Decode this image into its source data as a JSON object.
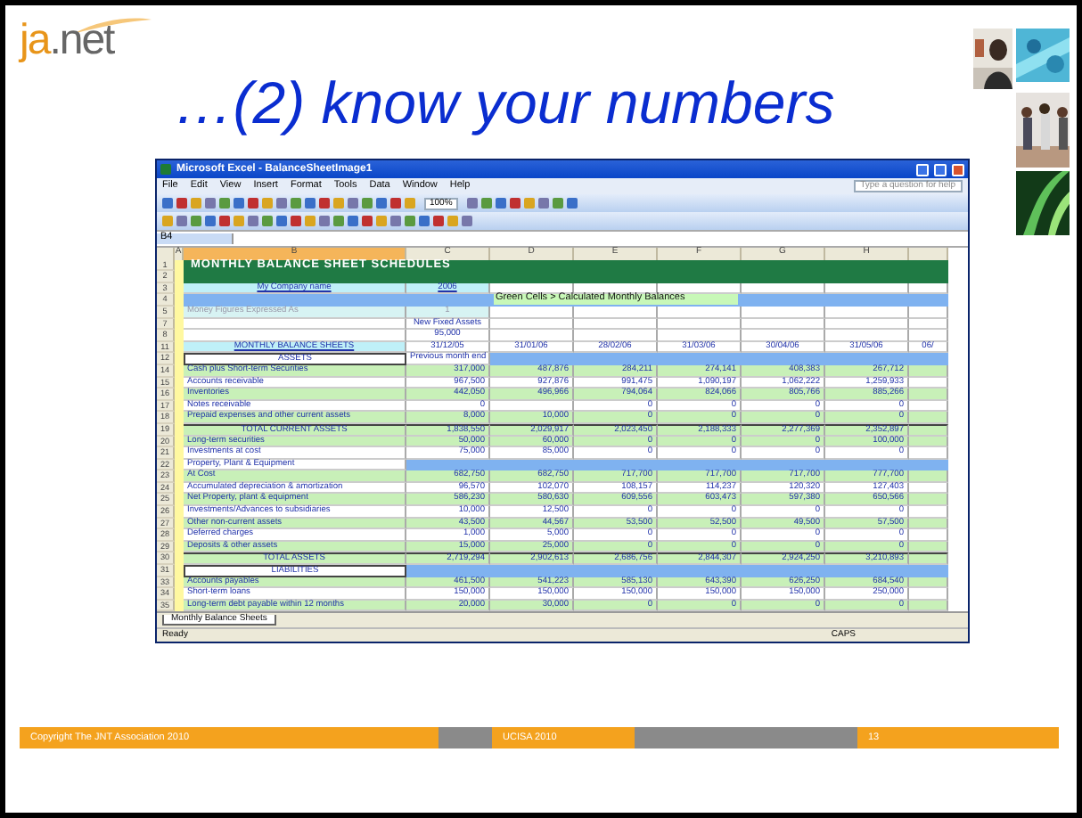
{
  "logo": {
    "prefix": "ja",
    "suffix": ".net"
  },
  "title": "…(2) know your numbers",
  "excel": {
    "window_title": "Microsoft Excel - BalanceSheetImage1",
    "menu": [
      "File",
      "Edit",
      "View",
      "Insert",
      "Format",
      "Tools",
      "Data",
      "Window",
      "Help"
    ],
    "help_placeholder": "Type a question for help",
    "zoom": "100%",
    "name_box": "B4",
    "columns": [
      "A",
      "B",
      "C",
      "D",
      "E",
      "F",
      "G",
      "H"
    ],
    "rows": [
      {
        "num": "1",
        "kind": "title",
        "label": "MONTHLY BALANCE SHEET SCHEDULES",
        "cells": []
      },
      {
        "num": "2",
        "kind": "title",
        "label": "",
        "cells": []
      },
      {
        "num": "3",
        "kind": "company",
        "label": "My Company name",
        "cells": [
          "2006"
        ]
      },
      {
        "num": "4",
        "kind": "banner",
        "label": "",
        "cells": [
          ""
        ],
        "note": "Green Cells > Calculated Monthly Balances"
      },
      {
        "num": "5",
        "kind": "grey",
        "label": "Money Figures Expressed As",
        "cells": [
          "1"
        ]
      },
      {
        "num": "7",
        "kind": "plain",
        "label": "",
        "cells": [
          "New Fixed Assets"
        ]
      },
      {
        "num": "8",
        "kind": "plain",
        "label": "",
        "cells": [
          "95,000"
        ]
      },
      {
        "num": "11",
        "kind": "dates",
        "label": "MONTHLY BALANCE SHEETS",
        "cells": [
          "31/12/05",
          "31/01/06",
          "28/02/06",
          "31/03/06",
          "30/04/06",
          "31/05/06",
          "06/"
        ]
      },
      {
        "num": "12",
        "kind": "section",
        "label": "ASSETS",
        "cells": [
          "Previous month end"
        ]
      },
      {
        "num": "14",
        "kind": "green",
        "label": "Cash plus Short-term Securities",
        "cells": [
          "317,000",
          "487,876",
          "284,211",
          "274,141",
          "408,383",
          "267,712"
        ]
      },
      {
        "num": "15",
        "kind": "white",
        "label": "Accounts receivable",
        "cells": [
          "967,500",
          "927,876",
          "991,475",
          "1,090,197",
          "1,062,222",
          "1,259,933"
        ]
      },
      {
        "num": "16",
        "kind": "green",
        "label": "Inventories",
        "cells": [
          "442,050",
          "496,966",
          "794,064",
          "824,066",
          "805,766",
          "885,266"
        ]
      },
      {
        "num": "17",
        "kind": "white",
        "label": "Notes receivable",
        "cells": [
          "0",
          "",
          "0",
          "0",
          "0",
          "0"
        ]
      },
      {
        "num": "18",
        "kind": "green",
        "label": "Prepaid expenses and other current assets",
        "cells": [
          "8,000",
          "10,000",
          "0",
          "0",
          "0",
          "0"
        ]
      },
      {
        "num": "19",
        "kind": "total",
        "label": "TOTAL CURRENT ASSETS",
        "cells": [
          "1,838,550",
          "2,029,917",
          "2,023,450",
          "2,188,333",
          "2,277,369",
          "2,352,897"
        ]
      },
      {
        "num": "20",
        "kind": "green",
        "label": "Long-term securities",
        "cells": [
          "50,000",
          "60,000",
          "0",
          "0",
          "0",
          "100,000"
        ]
      },
      {
        "num": "21",
        "kind": "white",
        "label": "Investments at cost",
        "cells": [
          "75,000",
          "85,000",
          "0",
          "0",
          "0",
          "0"
        ]
      },
      {
        "num": "22",
        "kind": "band",
        "label": "Property, Plant & Equipment",
        "cells": []
      },
      {
        "num": "23",
        "kind": "green",
        "label": "At Cost",
        "cells": [
          "682,750",
          "682,750",
          "717,700",
          "717,700",
          "717,700",
          "777,700"
        ]
      },
      {
        "num": "24",
        "kind": "white",
        "label": "Accumulated depreciation & amortization",
        "cells": [
          "96,570",
          "102,070",
          "108,157",
          "114,237",
          "120,320",
          "127,403"
        ]
      },
      {
        "num": "25",
        "kind": "green",
        "label": "Net Property, plant & equipment",
        "cells": [
          "586,230",
          "580,630",
          "609,556",
          "603,473",
          "597,380",
          "650,566"
        ]
      },
      {
        "num": "26",
        "kind": "white",
        "label": "Investments/Advances to subsidiaries",
        "cells": [
          "10,000",
          "12,500",
          "0",
          "0",
          "0",
          "0"
        ]
      },
      {
        "num": "27",
        "kind": "green",
        "label": "Other non-current assets",
        "cells": [
          "43,500",
          "44,567",
          "53,500",
          "52,500",
          "49,500",
          "57,500"
        ]
      },
      {
        "num": "28",
        "kind": "white",
        "label": "Deferred charges",
        "cells": [
          "1,000",
          "5,000",
          "0",
          "0",
          "0",
          "0"
        ]
      },
      {
        "num": "29",
        "kind": "green",
        "label": "Deposits & other assets",
        "cells": [
          "15,000",
          "25,000",
          "0",
          "0",
          "0",
          "0"
        ]
      },
      {
        "num": "30",
        "kind": "total",
        "label": "TOTAL ASSETS",
        "cells": [
          "2,719,294",
          "2,902,613",
          "2,686,756",
          "2,844,307",
          "2,924,250",
          "3,210,893"
        ]
      },
      {
        "num": "31",
        "kind": "section",
        "label": "LIABILITIES",
        "cells": []
      },
      {
        "num": "33",
        "kind": "green",
        "label": "Accounts payables",
        "cells": [
          "461,500",
          "541,223",
          "585,130",
          "643,390",
          "626,250",
          "684,540"
        ]
      },
      {
        "num": "34",
        "kind": "white",
        "label": "Short-term loans",
        "cells": [
          "150,000",
          "150,000",
          "150,000",
          "150,000",
          "150,000",
          "250,000"
        ]
      },
      {
        "num": "35",
        "kind": "green",
        "label": "Long-term debt payable within 12 months",
        "cells": [
          "20,000",
          "30,000",
          "0",
          "0",
          "0",
          "0"
        ]
      }
    ],
    "sheet_tab": "Monthly Balance Sheets",
    "status": "Ready",
    "caps": "CAPS"
  },
  "footer": [
    {
      "text": "Copyright The JNT Association 2010",
      "kind": "orange"
    },
    {
      "kind": "grey"
    },
    {
      "text": "UCISA 2010",
      "kind": "orange"
    },
    {
      "kind": "grey"
    },
    {
      "text": "13",
      "kind": "orange"
    }
  ]
}
